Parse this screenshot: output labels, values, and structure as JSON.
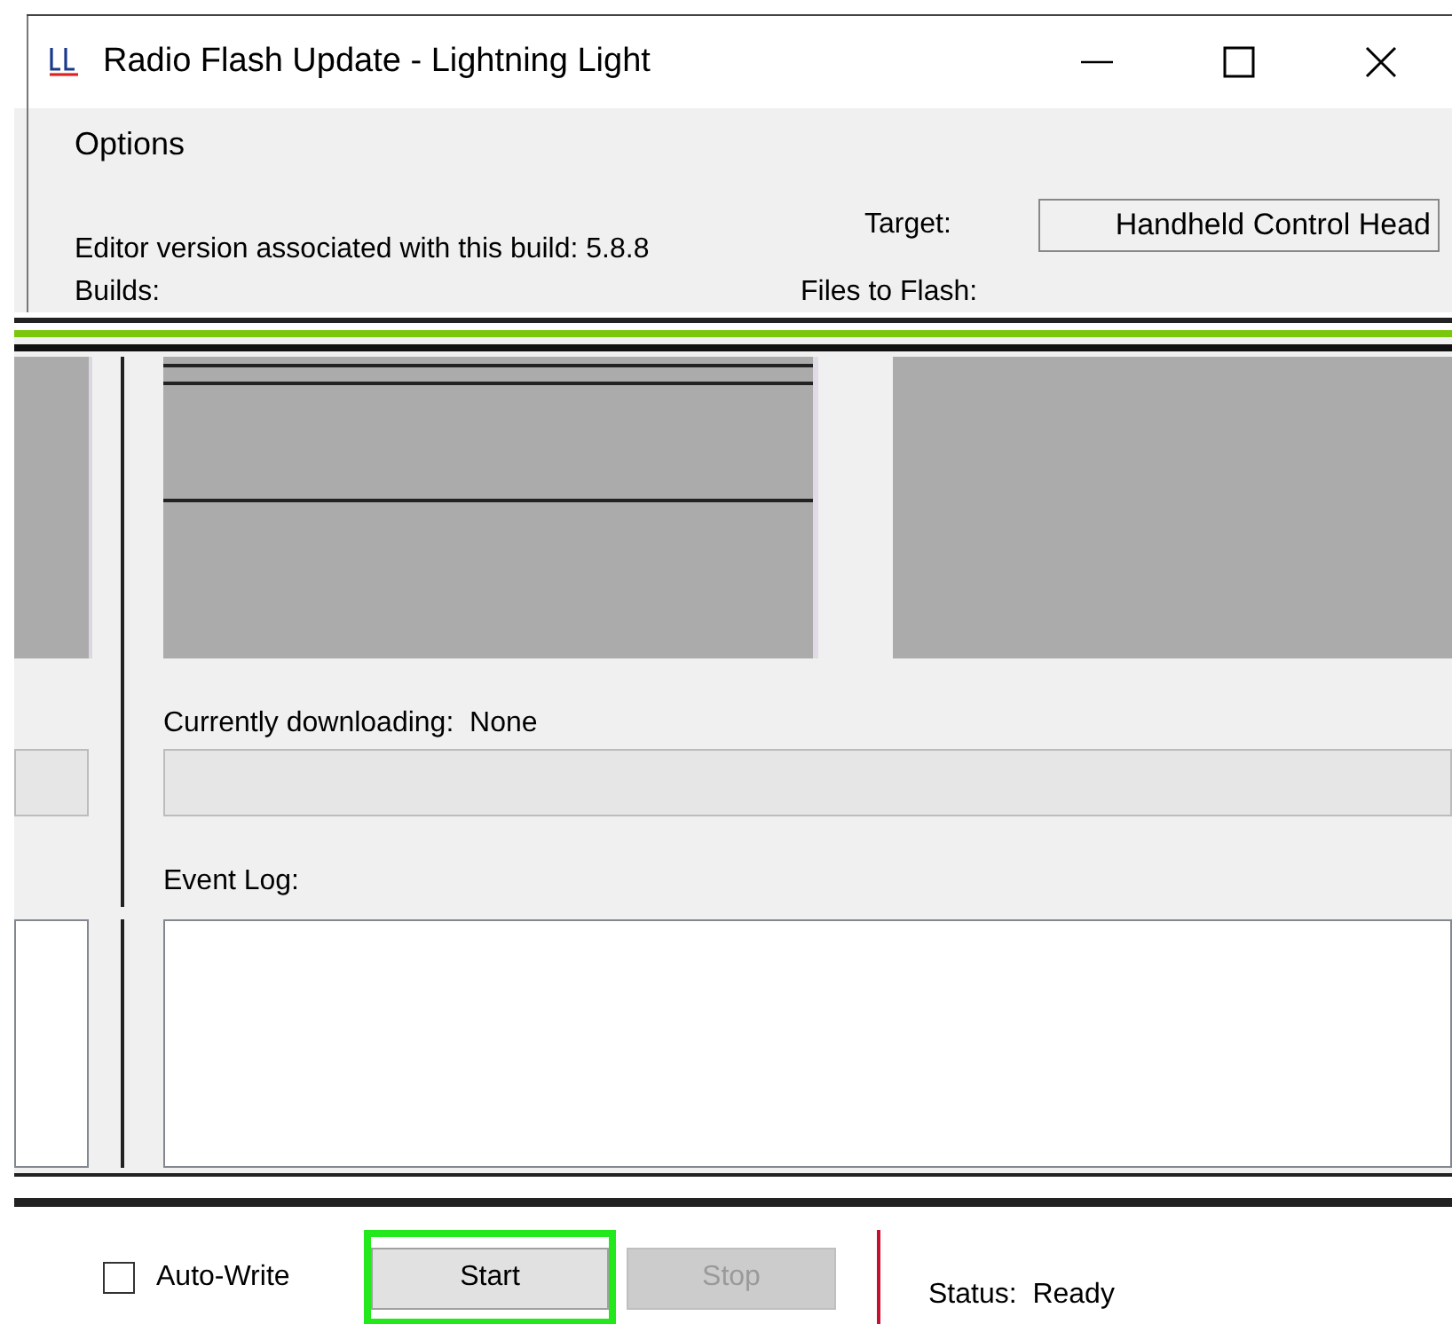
{
  "window": {
    "title": "Radio Flash Update - Lightning Light"
  },
  "menu": [
    {
      "label": "Options"
    }
  ],
  "editor_version": "Editor version associated with this build: 5.8.8",
  "target": {
    "label": "Target:",
    "value": "Handheld Control Head"
  },
  "builds": {
    "label": "Builds:"
  },
  "files_to_flash": {
    "label": "Files to Flash:"
  },
  "download": {
    "label": "Currently downloading:",
    "value": "None"
  },
  "event_log": {
    "label": "Event Log:"
  },
  "auto_write": {
    "label": "Auto-Write",
    "checked": false
  },
  "buttons": [
    {
      "label": "Start",
      "disabled": false,
      "highlighted": true
    },
    {
      "label": "Stop",
      "disabled": true,
      "highlighted": false
    }
  ],
  "status": {
    "label": "Status:",
    "value": "Ready"
  }
}
